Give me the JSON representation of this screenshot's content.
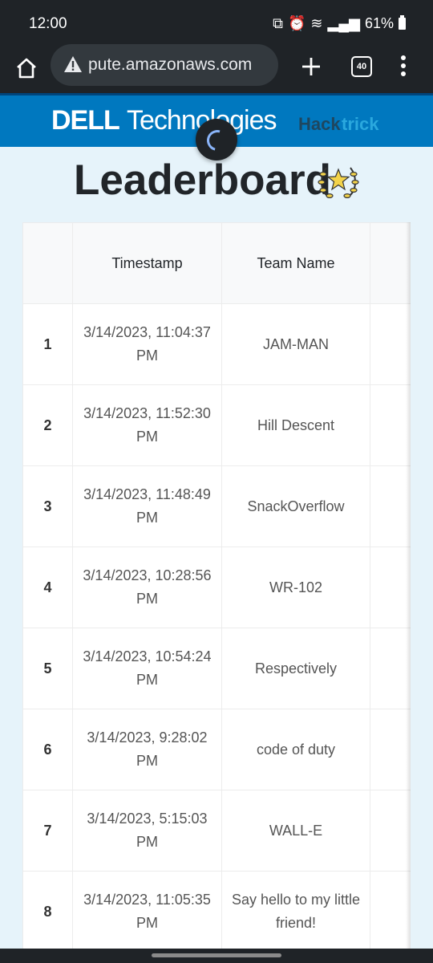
{
  "status_bar": {
    "time": "12:00",
    "battery": "61%"
  },
  "browser": {
    "url": "pute.amazonaws.com",
    "tab_count": "40"
  },
  "banner": {
    "brand_dell": "DELL",
    "brand_tech": "Technologies",
    "brand_hack": "Hack",
    "brand_trick": "trick"
  },
  "page": {
    "title": "Leaderboard"
  },
  "table": {
    "headers": {
      "rank": "",
      "timestamp": "Timestamp",
      "team": "Team Name",
      "extra": ""
    },
    "rows": [
      {
        "rank": "1",
        "timestamp": "3/14/2023, 11:04:37 PM",
        "team": "JAM-MAN"
      },
      {
        "rank": "2",
        "timestamp": "3/14/2023, 11:52:30 PM",
        "team": "Hill Descent"
      },
      {
        "rank": "3",
        "timestamp": "3/14/2023, 11:48:49 PM",
        "team": "SnackOverflow"
      },
      {
        "rank": "4",
        "timestamp": "3/14/2023, 10:28:56 PM",
        "team": "WR-102"
      },
      {
        "rank": "5",
        "timestamp": "3/14/2023, 10:54:24 PM",
        "team": "Respectively"
      },
      {
        "rank": "6",
        "timestamp": "3/14/2023, 9:28:02 PM",
        "team": "code of duty"
      },
      {
        "rank": "7",
        "timestamp": "3/14/2023, 5:15:03 PM",
        "team": "WALL-E"
      },
      {
        "rank": "8",
        "timestamp": "3/14/2023, 11:05:35 PM",
        "team": "Say hello to my little friend!"
      }
    ]
  },
  "icons": {
    "home": "home-icon",
    "warning": "warning-icon",
    "plus": "plus-icon",
    "tabs": "tabs-icon",
    "menu": "more-vert-icon",
    "spinner": "loading-spinner-icon",
    "trophy": "laurel-star-icon"
  },
  "colors": {
    "banner": "#0078bf",
    "page_bg": "#e6f3fa",
    "system_bar": "#1f2327",
    "hack_dark": "#1e4760",
    "trick_light": "#2aa8de"
  }
}
